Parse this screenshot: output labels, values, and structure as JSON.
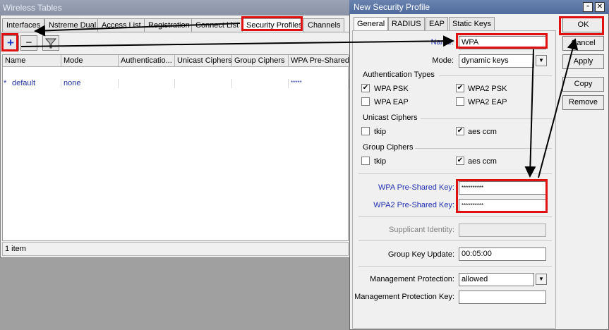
{
  "bg_window": {
    "title": "Wireless Tables",
    "tabs": [
      "Interfaces",
      "Nstreme Dual",
      "Access List",
      "Registration",
      "Connect List",
      "Security Profiles",
      "Channels"
    ],
    "toolbar": {
      "add": "+",
      "remove": "−",
      "filter": "filter-icon"
    },
    "columns": [
      "Name",
      "Mode",
      "Authenticatio...",
      "Unicast Ciphers",
      "Group Ciphers",
      "WPA Pre-Shared"
    ],
    "rows": [
      {
        "marker": "*",
        "name": "default",
        "mode": "none",
        "auth": "",
        "unicast": "",
        "group": "",
        "wpa": "*****"
      }
    ],
    "status": "1 item"
  },
  "dialog": {
    "title": "New Security Profile",
    "tabs": [
      "General",
      "RADIUS",
      "EAP",
      "Static Keys"
    ],
    "name_label": "Name:",
    "name_value": "WPA",
    "mode_label": "Mode:",
    "mode_value": "dynamic keys",
    "auth_types": {
      "title": "Authentication Types",
      "wpa_psk": {
        "label": "WPA PSK",
        "checked": true
      },
      "wpa2_psk": {
        "label": "WPA2 PSK",
        "checked": true
      },
      "wpa_eap": {
        "label": "WPA EAP",
        "checked": false
      },
      "wpa2_eap": {
        "label": "WPA2 EAP",
        "checked": false
      }
    },
    "unicast": {
      "title": "Unicast Ciphers",
      "tkip": {
        "label": "tkip",
        "checked": false
      },
      "aes": {
        "label": "aes ccm",
        "checked": true
      }
    },
    "group": {
      "title": "Group Ciphers",
      "tkip": {
        "label": "tkip",
        "checked": false
      },
      "aes": {
        "label": "aes ccm",
        "checked": true
      }
    },
    "wpa_key_label": "WPA Pre-Shared Key:",
    "wpa_key_value": "**********",
    "wpa2_key_label": "WPA2 Pre-Shared Key:",
    "wpa2_key_value": "**********",
    "supplicant_label": "Supplicant Identity:",
    "supplicant_value": "",
    "group_key_label": "Group Key Update:",
    "group_key_value": "00:05:00",
    "mgmt_prot_label": "Management Protection:",
    "mgmt_prot_value": "allowed",
    "mgmt_key_label": "Management Protection Key:",
    "mgmt_key_value": "",
    "buttons": {
      "ok": "OK",
      "cancel": "Cancel",
      "apply": "Apply",
      "copy": "Copy",
      "remove": "Remove"
    }
  },
  "colors": {
    "highlight": "#e01010",
    "arrow": "#000000",
    "link_text": "#2030b0"
  }
}
